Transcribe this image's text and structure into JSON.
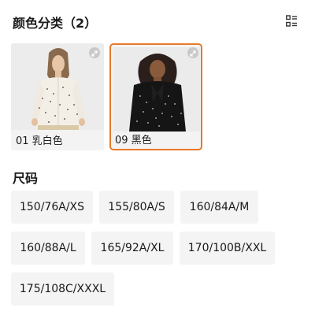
{
  "color_section": {
    "title": "颜色分类（2）",
    "view_toggle_icon": "list-view-icon",
    "items": [
      {
        "label": "01 乳白色",
        "selected": false,
        "expand_icon": "expand-icon"
      },
      {
        "label": "09 黑色",
        "selected": true,
        "expand_icon": "expand-icon"
      }
    ],
    "selected_border_color": "#e77a2a"
  },
  "size_section": {
    "title": "尺码",
    "options": [
      "150/76A/XS",
      "155/80A/S",
      "160/84A/M",
      "160/88A/L",
      "165/92A/XL",
      "170/100B/XXL",
      "175/108C/XXXL"
    ]
  }
}
